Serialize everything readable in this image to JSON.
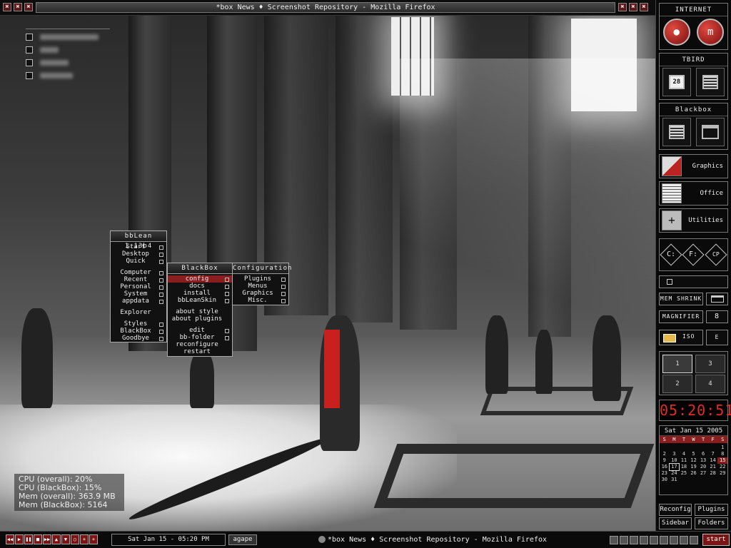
{
  "window_title": "*box News ♦ Screenshot Repository - Mozilla Firefox",
  "titlebar_buttons_left": [
    "✖",
    "✖",
    "✖"
  ],
  "titlebar_buttons_right": [
    "✖",
    "✖",
    "✖"
  ],
  "desktop": {
    "checklist_items": 4,
    "sysmon": {
      "cpu_overall": "CPU (overall): 20%",
      "cpu_blackbox": "CPU (BlackBox): 15%",
      "mem_overall": "Mem (overall): 363.9 MB",
      "mem_blackbox": "Mem (BlackBox): 5164"
    }
  },
  "root_menu": {
    "title": "bbLean 1.13b4",
    "items": [
      "Start",
      "Desktop",
      "Quick",
      "Computer",
      "Recent",
      "Personal",
      "System",
      "appdata",
      "Explorer",
      "Styles",
      "BlackBox",
      "Goodbye"
    ]
  },
  "blackbox_menu": {
    "title": "BlackBox",
    "items": [
      "config",
      "docs",
      "install",
      "bbLeanSkin",
      "about style",
      "about plugins",
      "edit",
      "bb-folder",
      "reconfigure",
      "restart"
    ]
  },
  "config_menu": {
    "title": "Configuration",
    "items": [
      "Plugins",
      "Menus",
      "Graphics",
      "Misc."
    ]
  },
  "slit": {
    "internet": {
      "title": "INTERNET"
    },
    "tbird": {
      "title": "TBIRD",
      "calendar_day": "28"
    },
    "blackbox": {
      "title": "Blackbox"
    },
    "apps": [
      "Graphics",
      "Office",
      "Utilities"
    ],
    "drives": [
      "C:",
      "F:",
      "CP"
    ],
    "mem_shrink": "MEM SHRINK",
    "magnifier": "MAGNIFIER",
    "magnifier_value": "8",
    "iso": "ISO",
    "e_btn": "E",
    "workspaces": [
      "1",
      "3",
      "2",
      "4"
    ],
    "clock": "05:20:51",
    "calendar": {
      "header": "Sat Jan 15 2005",
      "weekdays": [
        "S",
        "M",
        "T",
        "W",
        "T",
        "F",
        "S"
      ],
      "days": [
        "",
        "",
        "",
        "",
        "",
        "",
        "1",
        "2",
        "3",
        "4",
        "5",
        "6",
        "7",
        "8",
        "9",
        "10",
        "11",
        "12",
        "13",
        "14",
        "15",
        "16",
        "17",
        "18",
        "19",
        "20",
        "21",
        "22",
        "23",
        "24",
        "25",
        "26",
        "27",
        "28",
        "29",
        "30",
        "31",
        "",
        "",
        "",
        "",
        ""
      ],
      "today": "15",
      "selected": "17"
    },
    "buttons": [
      "Reconfig",
      "Plugins",
      "Sidebar",
      "Folders"
    ]
  },
  "taskbar": {
    "media_buttons": [
      "◀◀",
      "▶",
      "❚❚",
      "■",
      "▶▶",
      "▲",
      "▼",
      "○",
      "+",
      "+"
    ],
    "datetime": "Sat Jan 15 - 05:20 PM",
    "workspace": "agape",
    "task": "*box News ♦ Screenshot Repository - Mozilla Firefox",
    "start": "start"
  }
}
